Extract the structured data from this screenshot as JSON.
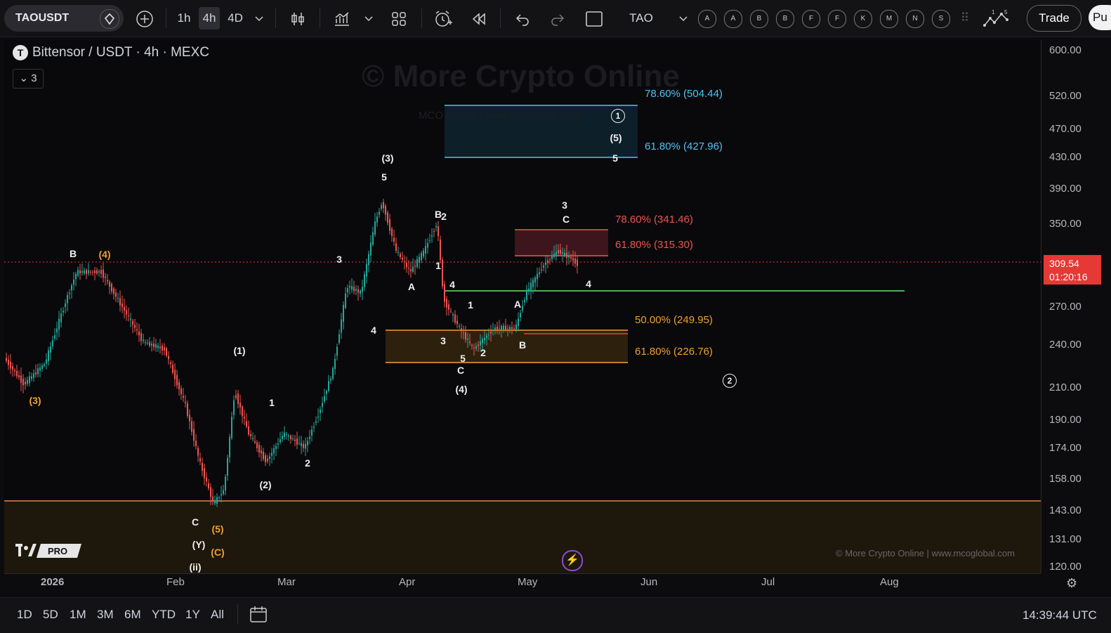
{
  "toolbar": {
    "symbol": "TAOUSDT",
    "interval_1h": "1h",
    "interval_4h": "4h",
    "interval_4d": "4D",
    "compare_symbol": "TAO",
    "alert_letters": [
      "A",
      "A",
      "B",
      "B",
      "F",
      "F",
      "K",
      "M",
      "N",
      "S"
    ],
    "trade_label": "Trade",
    "publish_label": "Pu"
  },
  "legend": {
    "title": "Bittensor / USDT · 4h · MEXC",
    "logo_letter": "T",
    "collapse_label": "⌄ 3"
  },
  "watermark": {
    "main": "© More Crypto Online",
    "sub": "MCO Global  |  www.mcoglobal.com",
    "footer": "© More Crypto Online   |   www.mcoglobal.com",
    "brand": "TV PRO"
  },
  "colors": {
    "up_candle": "#26a69a",
    "down_candle": "#ef5350",
    "fib_blue": "#4fc3f7",
    "fib_red": "#ef5350",
    "fib_orange": "#f0a030",
    "support_green": "#4caf50",
    "price_badge": "#e53935"
  },
  "price_axis": [
    "600.00",
    "520.00",
    "470.00",
    "430.00",
    "390.00",
    "350.00",
    "270.00",
    "240.00",
    "210.00",
    "190.00",
    "174.00",
    "158.00",
    "143.00",
    "131.00",
    "120.00"
  ],
  "current_price": {
    "value": "309.54",
    "countdown": "01:20:16"
  },
  "time_axis": [
    "2026",
    "Feb",
    "Mar",
    "Apr",
    "May",
    "Jun",
    "Jul",
    "Aug"
  ],
  "fib_levels": [
    {
      "label": "78.60% (504.44)",
      "color": "#4fc3f7"
    },
    {
      "label": "61.80% (427.96)",
      "color": "#4fc3f7"
    },
    {
      "label": "78.60% (341.46)",
      "color": "#ef5350"
    },
    {
      "label": "61.80% (315.30)",
      "color": "#ef5350"
    },
    {
      "label": "50.00% (249.95)",
      "color": "#f0a030"
    },
    {
      "label": "61.80% (226.76)",
      "color": "#f0a030"
    }
  ],
  "wave_labels": [
    {
      "t": "B",
      "c": "w"
    },
    {
      "t": "(4)",
      "c": "o"
    },
    {
      "t": "(3)",
      "c": "o"
    },
    {
      "t": "(1)",
      "c": "w"
    },
    {
      "t": "1",
      "c": "w"
    },
    {
      "t": "2",
      "c": "w"
    },
    {
      "t": "(2)",
      "c": "w"
    },
    {
      "t": "C",
      "c": "w"
    },
    {
      "t": "(Y)",
      "c": "w"
    },
    {
      "t": "(ii)",
      "c": "w"
    },
    {
      "t": "(5)",
      "c": "o"
    },
    {
      "t": "(C)",
      "c": "o"
    },
    {
      "t": "3",
      "c": "w"
    },
    {
      "t": "4",
      "c": "w"
    },
    {
      "t": "(3)",
      "c": "w"
    },
    {
      "t": "5",
      "c": "w"
    },
    {
      "t": "A",
      "c": "w"
    },
    {
      "t": "B",
      "c": "w"
    },
    {
      "t": "2",
      "c": "w"
    },
    {
      "t": "1",
      "c": "w"
    },
    {
      "t": "4",
      "c": "w"
    },
    {
      "t": "3",
      "c": "w"
    },
    {
      "t": "5",
      "c": "w"
    },
    {
      "t": "C",
      "c": "w"
    },
    {
      "t": "(4)",
      "c": "w"
    },
    {
      "t": "1",
      "c": "w"
    },
    {
      "t": "2",
      "c": "w"
    },
    {
      "t": "A",
      "c": "w"
    },
    {
      "t": "B",
      "c": "w"
    },
    {
      "t": "3",
      "c": "w"
    },
    {
      "t": "C",
      "c": "w"
    },
    {
      "t": "4",
      "c": "w"
    },
    {
      "t": "(5)",
      "c": "w"
    },
    {
      "t": "5",
      "c": "w"
    }
  ],
  "circled_labels": [
    "1",
    "2"
  ],
  "ranges": [
    "1D",
    "5D",
    "1M",
    "3M",
    "6M",
    "YTD",
    "1Y",
    "All"
  ],
  "clock": "14:39:44 UTC"
}
